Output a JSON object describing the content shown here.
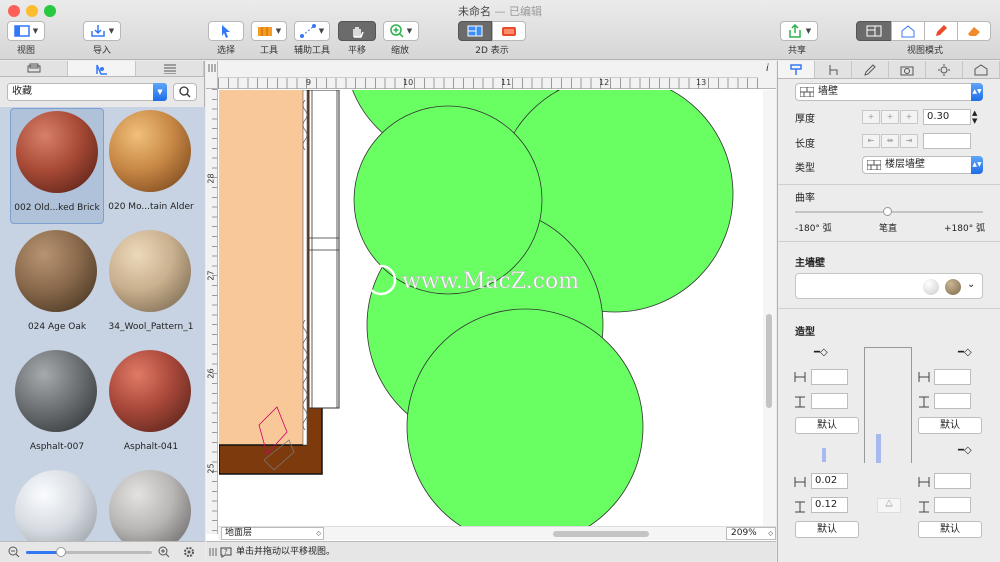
{
  "window": {
    "title": "未命名",
    "subtitle": "— 已编辑"
  },
  "toolbar": {
    "view": "视图",
    "import": "导入",
    "select": "选择",
    "tools": "工具",
    "aux_tools": "辅助工具",
    "pan": "平移",
    "zoom": "缩放",
    "display_2d": "2D 表示",
    "share": "共享",
    "view_mode": "视图模式"
  },
  "library": {
    "category": "收藏",
    "materials": [
      {
        "label": "002 Old...ked Brick",
        "color": "#a84a36"
      },
      {
        "label": "020 Mo...tain Alder",
        "color": "#c88846"
      },
      {
        "label": "024 Age Oak",
        "color": "#8a6a4c"
      },
      {
        "label": "34_Wool_Pattern_1",
        "color": "#c9b08e"
      },
      {
        "label": "Asphalt-007",
        "color": "#6d7174"
      },
      {
        "label": "Asphalt-041",
        "color": "#a8483a"
      },
      {
        "label": "",
        "color": "#d7dce2"
      },
      {
        "label": "",
        "color": "#b9b7b5"
      }
    ]
  },
  "canvas": {
    "ruler_top": [
      "9",
      "10",
      "11",
      "12",
      "13"
    ],
    "ruler_left": [
      "28",
      "27",
      "26",
      "25"
    ],
    "watermark": "www.MacZ.com",
    "floor": "地面层",
    "zoom": "209%",
    "status": "单击并拖动以平移视图。",
    "info_icon": "i"
  },
  "inspector": {
    "type": "墙壁",
    "thickness_label": "厚度",
    "thickness": "0.30",
    "length_label": "长度",
    "length": "",
    "kind_label": "类型",
    "kind": "楼层墙壁",
    "curvature_label": "曲率",
    "curve_min": "-180° 弧",
    "curve_mid": "笔直",
    "curve_max": "+180° 弧",
    "curve_value": 0.5,
    "main_wall": "主墙壁",
    "shape": "造型",
    "default": "默认",
    "value_a": "0.02",
    "value_b": "0.12"
  }
}
